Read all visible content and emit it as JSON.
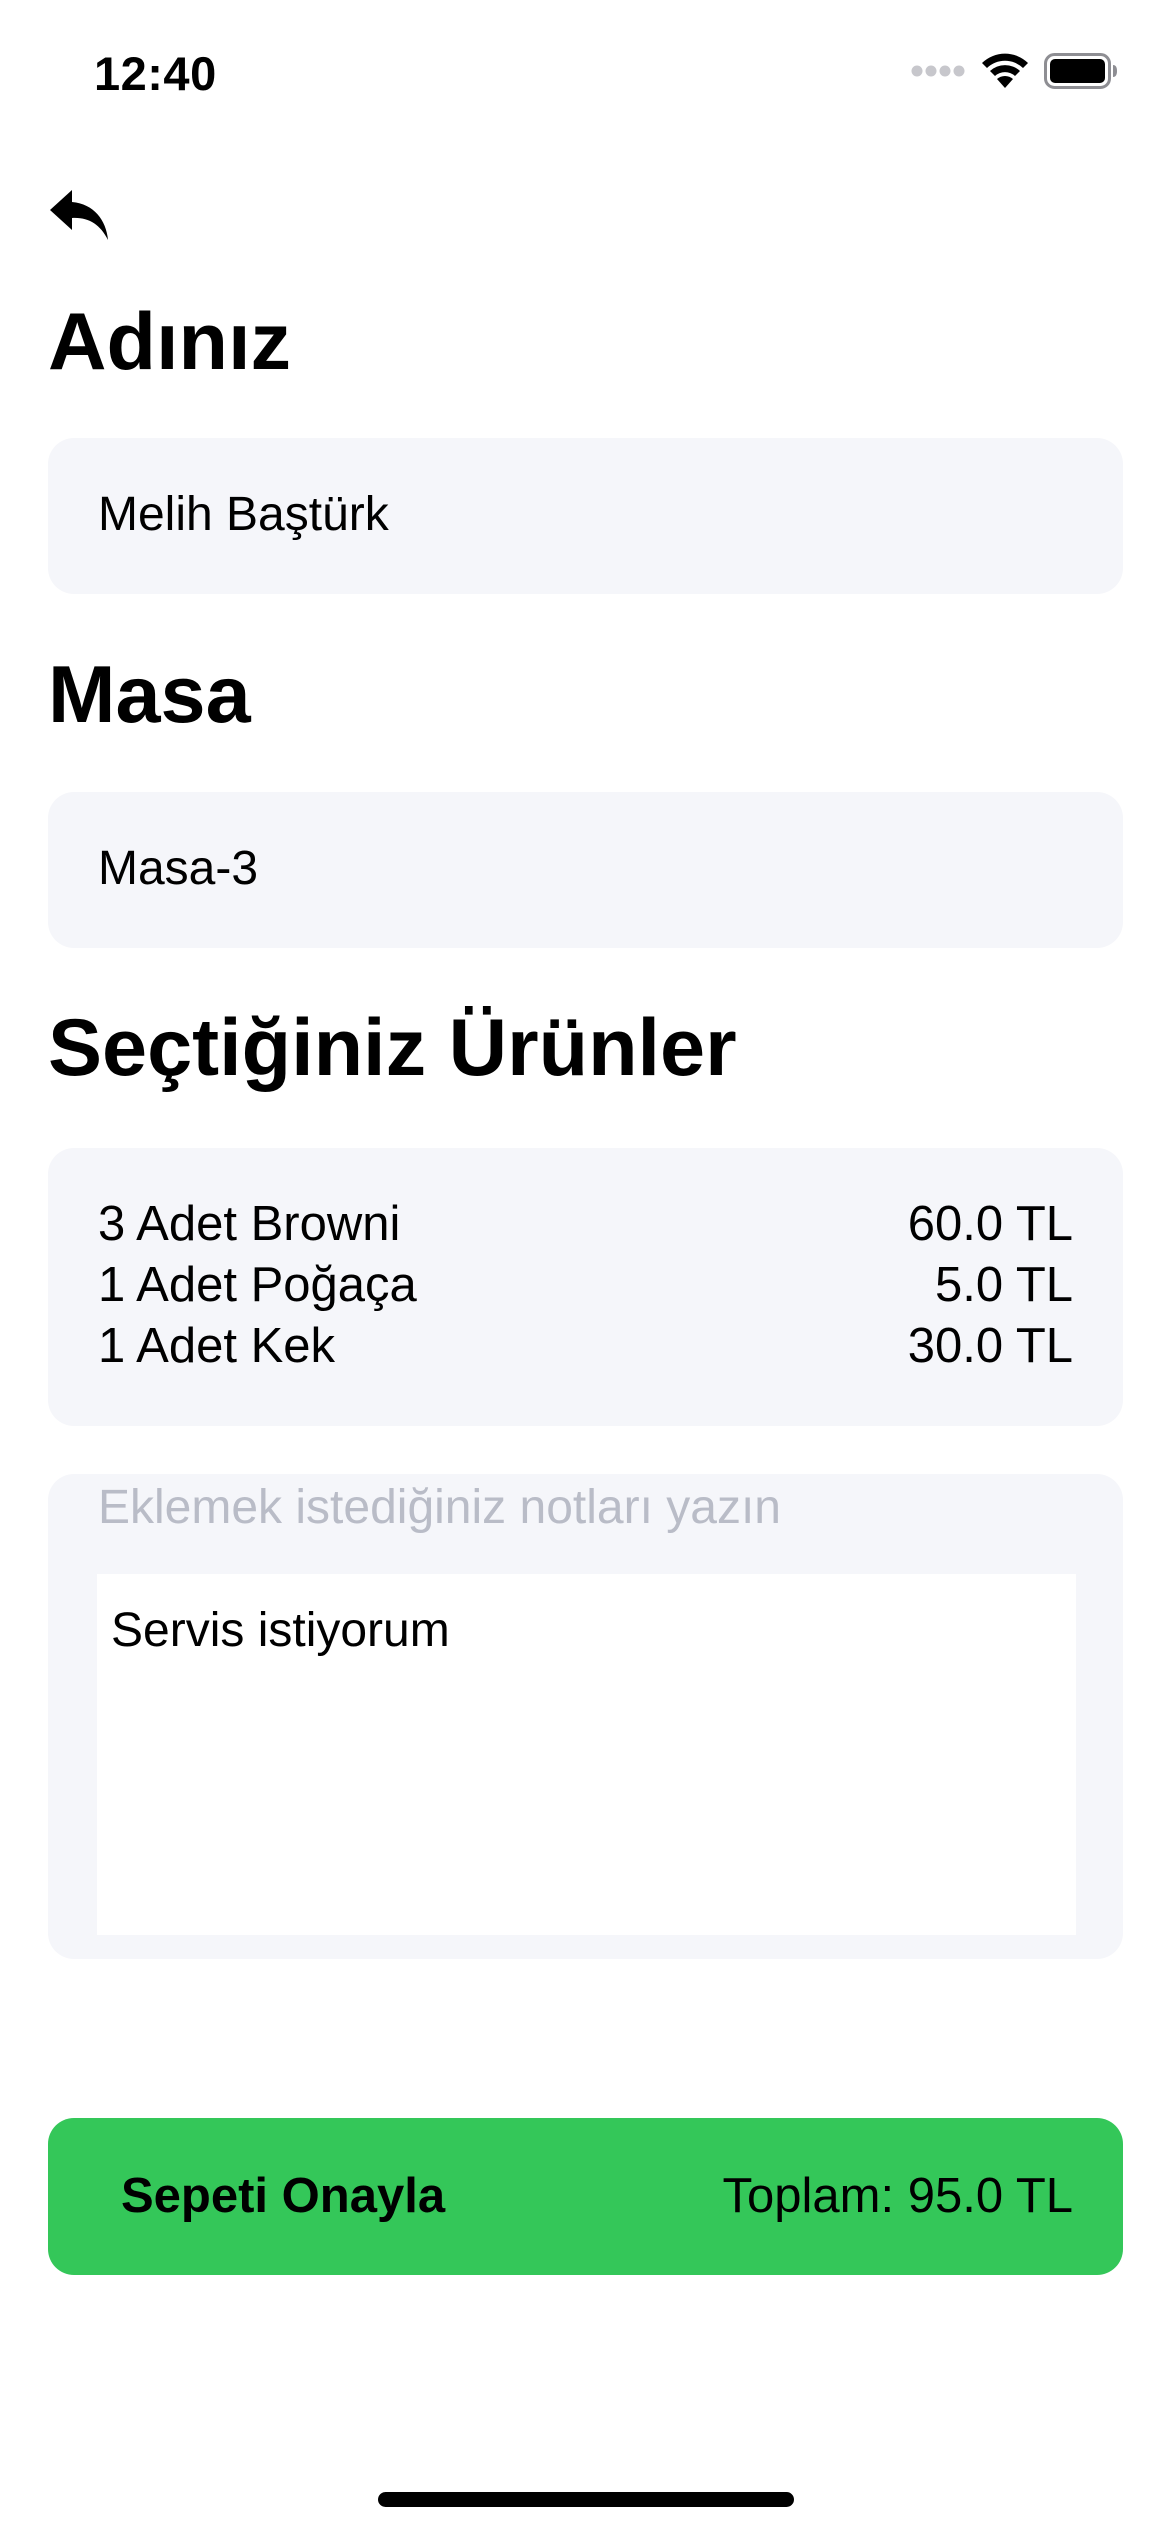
{
  "status_bar": {
    "time": "12:40",
    "icons": [
      "signal-dots-icon",
      "wifi-icon",
      "battery-icon"
    ]
  },
  "nav": {
    "back_icon": "back-arrow-icon"
  },
  "name_section": {
    "title": "Adınız",
    "value": "Melih Baştürk"
  },
  "table_section": {
    "title": "Masa",
    "value": "Masa-3"
  },
  "products_section": {
    "title": "Seçtiğiniz Ürünler",
    "items": [
      {
        "label": "3 Adet Browni",
        "price": "60.0 TL"
      },
      {
        "label": "1 Adet Poğaça",
        "price": "5.0 TL"
      },
      {
        "label": "1 Adet Kek",
        "price": "30.0 TL"
      }
    ]
  },
  "notes": {
    "placeholder": "Eklemek istediğiniz notları yazın",
    "value": "Servis istiyorum"
  },
  "confirm": {
    "label": "Sepeti Onayla",
    "total": "Toplam: 95.0 TL"
  },
  "colors": {
    "accent_green": "#34c759",
    "field_background": "#f5f6fa",
    "placeholder_gray": "#b9bcc7"
  }
}
